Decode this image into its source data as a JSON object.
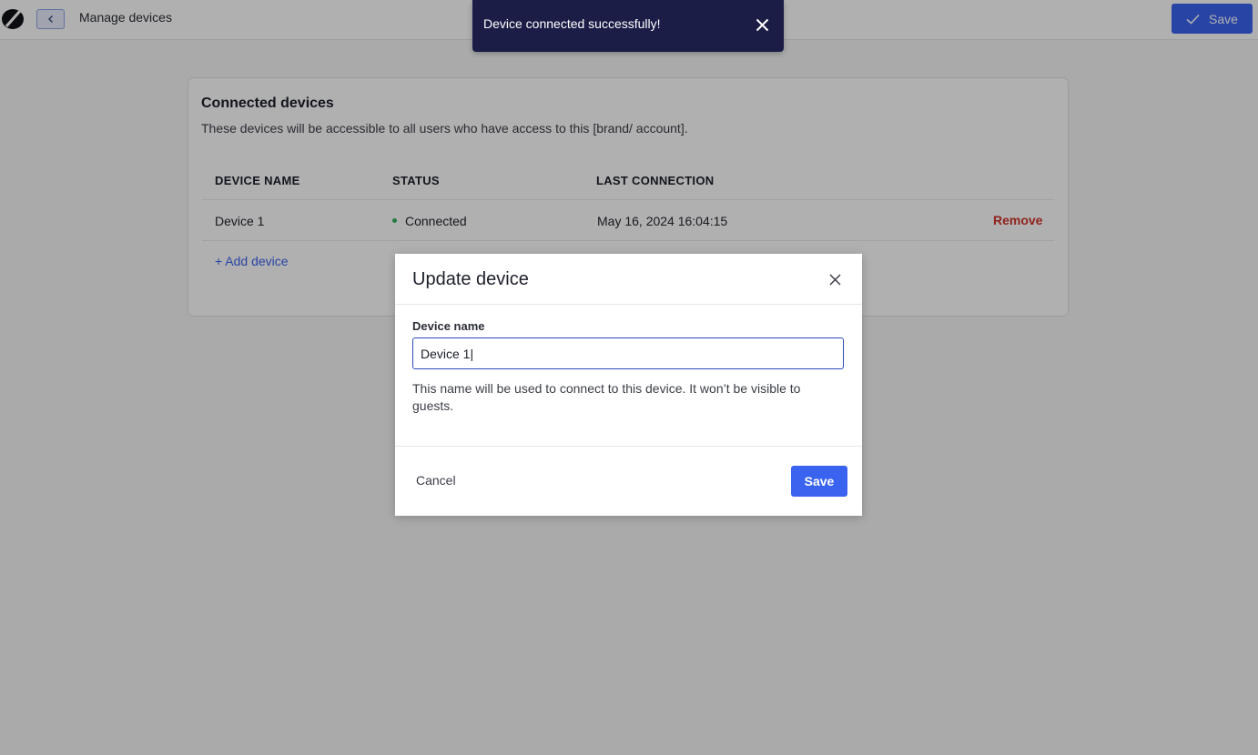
{
  "header": {
    "title": "Manage devices",
    "save_label": "Save"
  },
  "card": {
    "title": "Connected devices",
    "description": "These devices will be accessible to all users who have access to this [brand/ account].",
    "columns": [
      "DEVICE NAME",
      "STATUS",
      "LAST CONNECTION"
    ],
    "rows": [
      {
        "name": "Device 1",
        "status": "Connected",
        "last_connection": "May 16, 2024 16:04:15",
        "action": "Remove"
      }
    ],
    "add_label": "+ Add device"
  },
  "toast": {
    "message": "Device connected successfully!"
  },
  "modal": {
    "title": "Update device",
    "field_label": "Device name",
    "field_value": "Device 1|",
    "help_text": "This name will be used to connect to this device. It won’t be visible to guests.",
    "cancel_label": "Cancel",
    "save_label": "Save"
  },
  "colors": {
    "primary": "#3a63f0",
    "toast_bg": "#1b1d47",
    "danger": "#d0342c",
    "status_connected": "#2fb35a"
  },
  "icons": {
    "logo": "brand-logo-icon",
    "back": "chevron-left-icon",
    "check": "check-icon",
    "close": "close-icon"
  }
}
